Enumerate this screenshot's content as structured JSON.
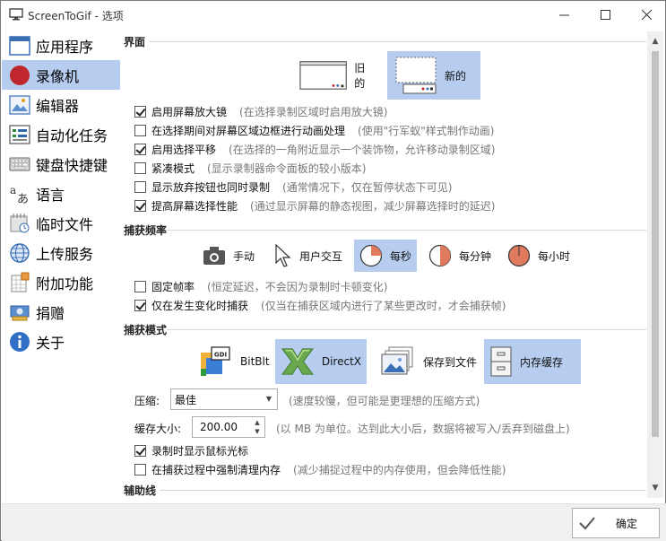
{
  "window": {
    "title": "ScreenToGif - 选项"
  },
  "sidebar": {
    "items": [
      {
        "label": "应用程序",
        "icon": "window-icon"
      },
      {
        "label": "录像机",
        "icon": "record-icon"
      },
      {
        "label": "编辑器",
        "icon": "editor-icon"
      },
      {
        "label": "自动化任务",
        "icon": "tasks-icon"
      },
      {
        "label": "键盘快捷键",
        "icon": "keyboard-icon"
      },
      {
        "label": "语言",
        "icon": "language-icon"
      },
      {
        "label": "临时文件",
        "icon": "temp-files-icon"
      },
      {
        "label": "上传服务",
        "icon": "globe-icon"
      },
      {
        "label": "附加功能",
        "icon": "extras-icon"
      },
      {
        "label": "捐赠",
        "icon": "donate-icon"
      },
      {
        "label": "关于",
        "icon": "info-icon"
      }
    ]
  },
  "interface": {
    "title": "界面",
    "old_label": "旧的",
    "new_label": "新的",
    "options": [
      {
        "label": "启用屏幕放大镜",
        "hint": "(在选择录制区域时启用放大镜)",
        "checked": true
      },
      {
        "label": "在选择期间对屏幕区域边框进行动画处理",
        "hint": "(使用\"行军蚁\"样式制作动画)",
        "checked": false
      },
      {
        "label": "启用选择平移",
        "hint": "(在选择的一角附近显示一个装饰物，允许移动录制区域)",
        "checked": true
      },
      {
        "label": "紧凑模式",
        "hint": "(显示录制器命令面板的较小版本)",
        "checked": false
      },
      {
        "label": "显示放弃按钮也同时录制",
        "hint": "(通常情况下，仅在暂停状态下可见)",
        "checked": false
      },
      {
        "label": "提高屏幕选择性能",
        "hint": "(通过显示屏幕的静态视图，减少屏幕选择时的延迟)",
        "checked": true
      }
    ]
  },
  "capture_freq": {
    "title": "捕获频率",
    "modes": [
      "手动",
      "用户交互",
      "每秒",
      "每分钟",
      "每小时"
    ],
    "options": [
      {
        "label": "固定帧率",
        "hint": "(恒定延迟，不会因为录制时卡顿变化)",
        "checked": false
      },
      {
        "label": "仅在发生变化时捕获",
        "hint": "(仅当在捕获区域内进行了某些更改时，才会捕获帧)",
        "checked": true
      }
    ]
  },
  "capture_mode": {
    "title": "捕获模式",
    "modes": [
      "BitBlt",
      "DirectX",
      "保存到文件",
      "内存缓存"
    ],
    "gdi_badge": "GDI",
    "compression_label": "压缩:",
    "compression_value": "最佳",
    "compression_hint": "(速度较慢，但可能是更理想的压缩方式)",
    "cache_label": "缓存大小:",
    "cache_value": "200.00",
    "cache_hint": "(以 MB 为单位。达到此大小后，数据将被写入/丢弃到磁盘上)",
    "options": [
      {
        "label": "录制时显示鼠标光标",
        "hint": "",
        "checked": true
      },
      {
        "label": "在捕获过程中强制清理内存",
        "hint": "(减少捕捉过程中的内存使用，但会降低性能)",
        "checked": false
      }
    ]
  },
  "guides": {
    "title": "辅助线"
  },
  "footer": {
    "ok_label": "确定"
  },
  "colors": {
    "accent": "#b6cdf0",
    "record": "#c0262d"
  }
}
